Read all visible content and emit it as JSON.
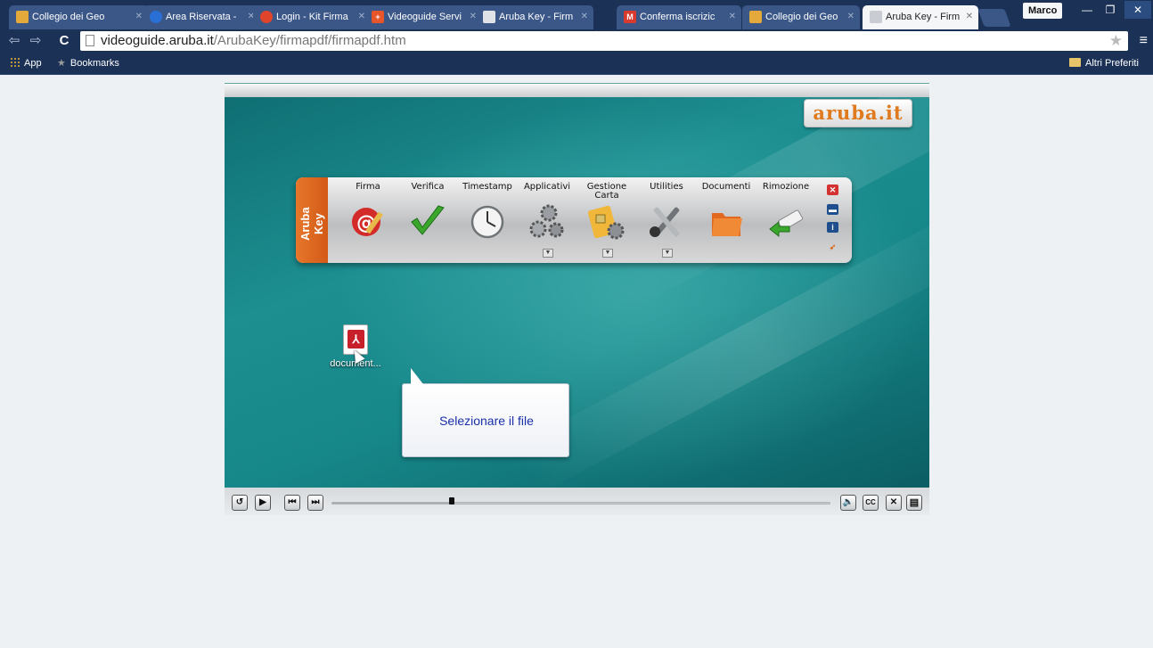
{
  "browser": {
    "tabs": [
      {
        "title": "Collegio dei Geo",
        "favicon_color": "#e3a93a",
        "active": false
      },
      {
        "title": "Area Riservata - ",
        "favicon_color": "#2a6fd6",
        "active": false
      },
      {
        "title": "Login - Kit Firma",
        "favicon_color": "#e0452b",
        "active": false
      },
      {
        "title": "Videoguide Servi",
        "favicon_color": "#e8552a",
        "active": false
      },
      {
        "title": "Aruba Key - Firm",
        "favicon_color": "#dfe3e8",
        "active": false
      },
      {
        "title": "Conferma iscrizic",
        "favicon_color": "#d93a2e",
        "active": false
      },
      {
        "title": "Collegio dei Geo",
        "favicon_color": "#e3a93a",
        "active": false
      },
      {
        "title": "Aruba Key - Firm",
        "favicon_color": "#c9cdd3",
        "active": true
      }
    ],
    "profile_name": "Marco",
    "url_host": "videoguide.aruba.it",
    "url_path": "/ArubaKey/firmapdf/firmapdf.htm",
    "bookmarks": {
      "apps_label": "App",
      "bookmarks_label": "Bookmarks",
      "other_label": "Altri Preferiti"
    }
  },
  "player": {
    "logo_text": "aruba.it",
    "palette_title": "Aruba Key",
    "palette_items": [
      {
        "label": "Firma",
        "icon": "at-sign-pen-icon"
      },
      {
        "label": "Verifica",
        "icon": "checkmark-icon"
      },
      {
        "label": "Timestamp",
        "icon": "clock-icon"
      },
      {
        "label": "Applicativi",
        "icon": "gears-icon"
      },
      {
        "label": "Gestione\nCarta",
        "icon": "smartcard-gear-icon"
      },
      {
        "label": "Utilities",
        "icon": "tools-icon"
      },
      {
        "label": "Documenti",
        "icon": "folder-icon"
      },
      {
        "label": "Rimozione",
        "icon": "usb-key-icon"
      }
    ],
    "file_name": "document...",
    "callout_text": "Selezionare il file",
    "seek_progress": 0.24
  },
  "colors": {
    "chrome_dark": "#1b3156",
    "accent_orange": "#e06a22",
    "callout_text": "#1a2fa8"
  }
}
